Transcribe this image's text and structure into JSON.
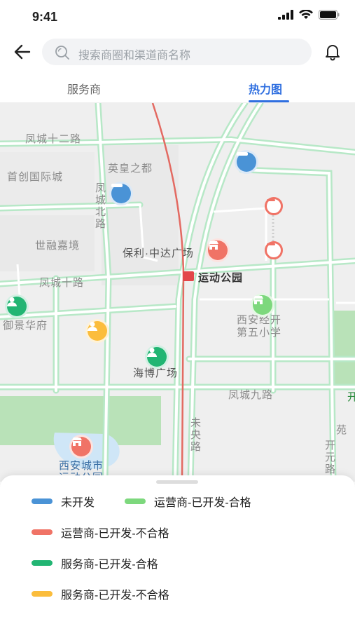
{
  "status_bar": {
    "time": "9:41"
  },
  "header": {
    "search_placeholder": "搜索商圈和渠道商名称"
  },
  "tabs": [
    {
      "label": "服务商",
      "active": false
    },
    {
      "label": "热力图",
      "active": true
    }
  ],
  "map": {
    "labels": {
      "fengcheng12": "凤城十二路",
      "yinghuang": "英皇之都",
      "shouchuang": "首创国际城",
      "fengchengbei": "凤城北路",
      "shirong": "世融嘉境",
      "baoli": "保利·中达广场",
      "fengcheng10": "凤城十路",
      "metro": "运动公园",
      "yujing": "御景华府",
      "xian_school_1": "西安经开",
      "xian_school_2": "第五小学",
      "haibo": "海博广场",
      "fengcheng9": "凤城九路",
      "weiyang": "未央路",
      "kaiyuan": "开元路",
      "yuan": "苑",
      "kai": "开",
      "park_1": "西安城市",
      "park_2": "运动公园"
    }
  },
  "legend": [
    {
      "label": "未开发",
      "color": "#4a93d6"
    },
    {
      "label": "运营商-已开发-合格",
      "color": "#7dd87d"
    },
    {
      "label": "运营商-已开发-不合格",
      "color": "#f07366"
    },
    {
      "label": "服务商-已开发-合格",
      "color": "#22b573"
    },
    {
      "label": "服务商-已开发-不合格",
      "color": "#fbbd3c"
    }
  ]
}
